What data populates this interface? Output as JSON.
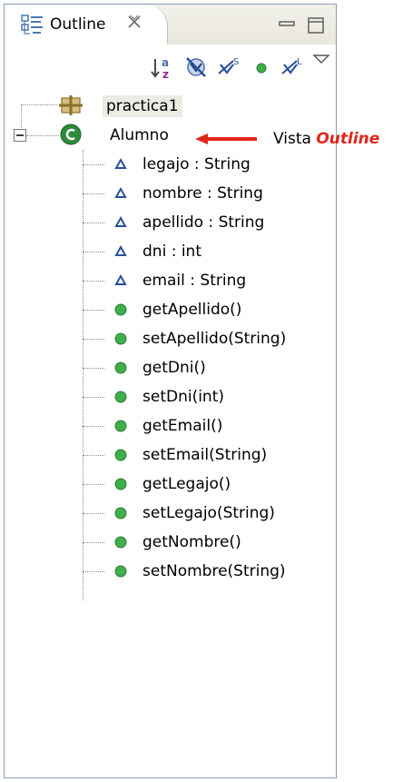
{
  "view": {
    "tab_title": "Outline",
    "tab_icon": "outline-view-icon",
    "close_icon": "close-icon"
  },
  "toolbar": {
    "buttons": [
      {
        "name": "sort-icon"
      },
      {
        "name": "hide-fields-icon"
      },
      {
        "name": "hide-static-members-icon"
      },
      {
        "name": "hide-non-public-members-icon"
      },
      {
        "name": "hide-local-types-icon"
      }
    ],
    "menu_icon": "view-menu-icon"
  },
  "tree": {
    "package": {
      "label": "practica1",
      "icon": "package-declaration-icon"
    },
    "class": {
      "label": "Alumno",
      "icon": "class-icon",
      "expanded": true
    },
    "members": [
      {
        "label": "legajo : String",
        "kind": "field"
      },
      {
        "label": "nombre : String",
        "kind": "field"
      },
      {
        "label": "apellido : String",
        "kind": "field"
      },
      {
        "label": "dni : int",
        "kind": "field"
      },
      {
        "label": "email : String",
        "kind": "field"
      },
      {
        "label": "getApellido()",
        "kind": "method"
      },
      {
        "label": "setApellido(String)",
        "kind": "method"
      },
      {
        "label": "getDni()",
        "kind": "method"
      },
      {
        "label": "setDni(int)",
        "kind": "method"
      },
      {
        "label": "getEmail()",
        "kind": "method"
      },
      {
        "label": "setEmail(String)",
        "kind": "method"
      },
      {
        "label": "getLegajo()",
        "kind": "method"
      },
      {
        "label": "setLegajo(String)",
        "kind": "method"
      },
      {
        "label": "getNombre()",
        "kind": "method"
      },
      {
        "label": "setNombre(String)",
        "kind": "method"
      }
    ]
  },
  "annotation": {
    "prefix": "Vista",
    "emphasis": "Outline",
    "arrow_color": "#e0261a"
  },
  "colors": {
    "method_green": "#3fae4b",
    "field_blue": "#2a4f9c",
    "class_green": "#2e8b3a",
    "highlight_red": "#e0261a"
  }
}
